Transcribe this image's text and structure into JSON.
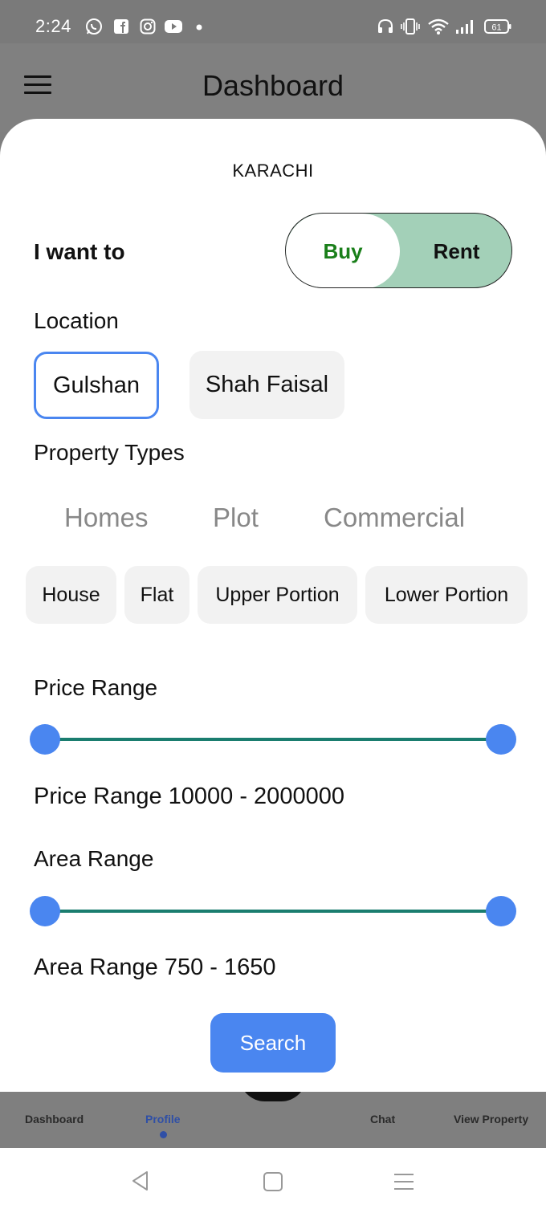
{
  "status_bar": {
    "time": "2:24",
    "battery": "61",
    "left_icons": [
      "whatsapp-icon",
      "facebook-icon",
      "instagram-icon",
      "youtube-icon",
      "dot-icon"
    ],
    "right_icons": [
      "headset-icon",
      "vibrate-icon",
      "wifi-icon",
      "signal-icon",
      "battery-icon"
    ]
  },
  "header": {
    "title": "Dashboard"
  },
  "filter": {
    "city": "KARACHI",
    "want_label": "I want to",
    "toggle": {
      "buy": "Buy",
      "rent": "Rent",
      "selected": "Buy"
    },
    "location_label": "Location",
    "locations": [
      {
        "label": "Gulshan",
        "selected": true
      },
      {
        "label": "Shah Faisal",
        "selected": false
      }
    ],
    "property_types_label": "Property Types",
    "type_tabs": [
      "Homes",
      "Plot",
      "Commercial"
    ],
    "subtypes": [
      "House",
      "Flat",
      "Upper Portion",
      "Lower Portion"
    ],
    "price_label": "Price Range",
    "price_value_text": "Price Range 10000 - 2000000",
    "price_slider": {
      "min": 10000,
      "max": 2000000,
      "low": 10000,
      "high": 2000000
    },
    "area_label": "Area Range",
    "area_value_text": "Area Range 750 - 1650",
    "area_slider": {
      "min": 750,
      "max": 1650,
      "low": 750,
      "high": 1650
    },
    "search_label": "Search"
  },
  "bottom_nav": {
    "items": [
      {
        "label": "Dashboard",
        "active": false
      },
      {
        "label": "Profile",
        "active": true
      },
      {
        "label": "Chat",
        "active": false
      },
      {
        "label": "View Property",
        "active": false
      }
    ]
  },
  "system_nav": [
    "back-icon",
    "home-icon",
    "recents-icon"
  ],
  "colors": {
    "accent": "#4a86f0",
    "buy_text": "#1a7f1a",
    "toggle_bg": "#a3d0b8",
    "slider_track": "#1a7d6f",
    "nav_active": "#2f4fa6",
    "overlay": "#7f7f7f"
  }
}
